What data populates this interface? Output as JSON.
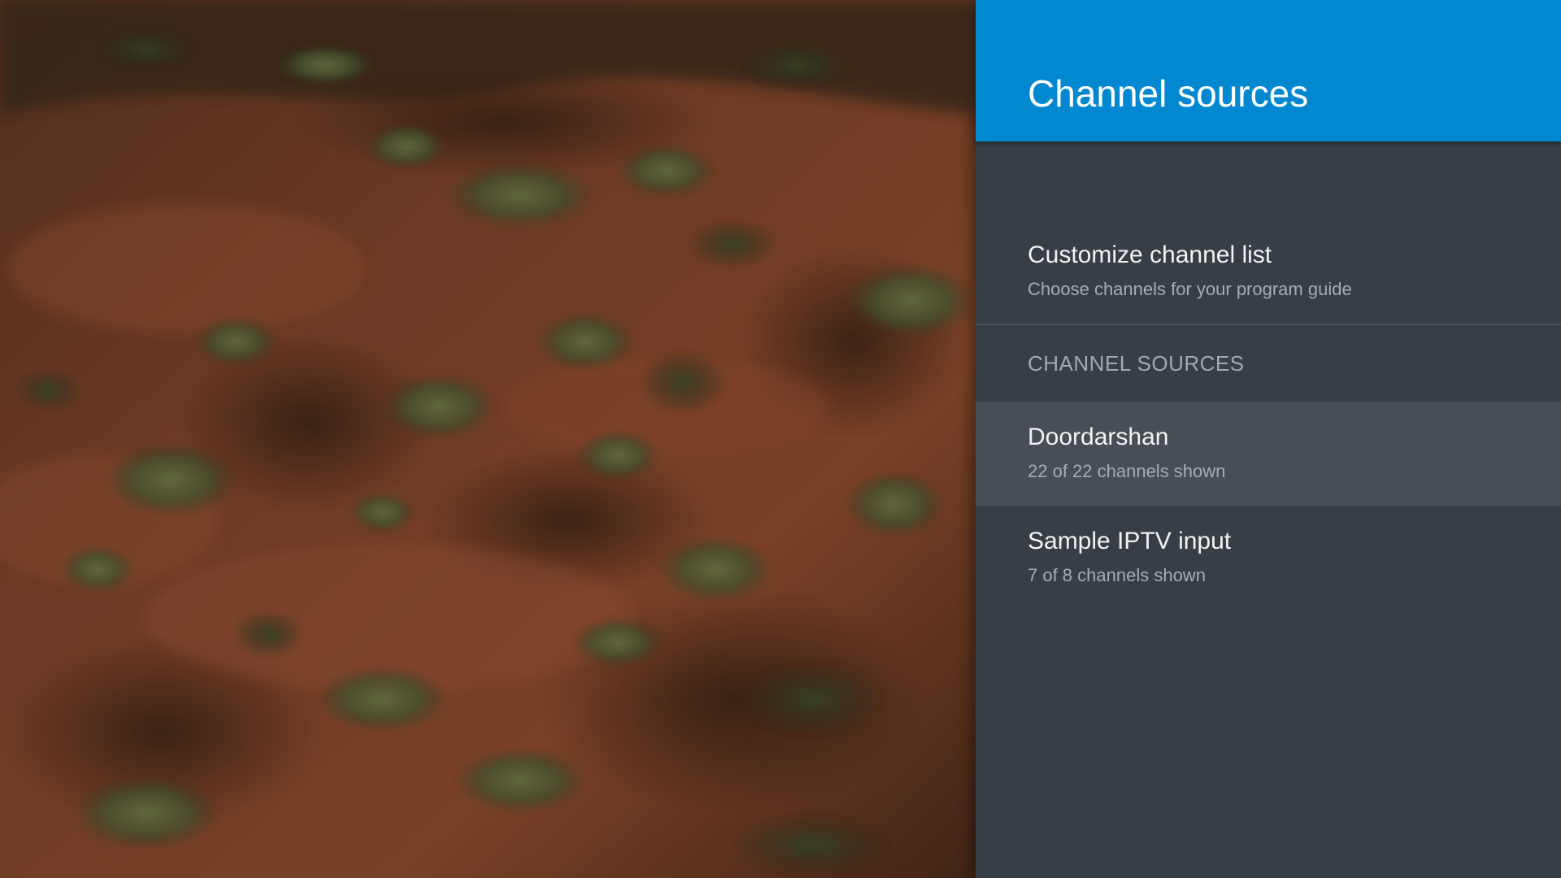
{
  "panel": {
    "title": "Channel sources",
    "header_color": "#0288d1",
    "background_color": "#373e46",
    "focused_color": "#474e56"
  },
  "customize": {
    "title": "Customize channel list",
    "subtitle": "Choose channels for your program guide"
  },
  "section": {
    "header": "CHANNEL SOURCES"
  },
  "sources": [
    {
      "title": "Doordarshan",
      "subtitle": "22 of 22 channels shown",
      "focused": true
    },
    {
      "title": "Sample IPTV input",
      "subtitle": "7 of 8 channels shown",
      "focused": false
    }
  ]
}
